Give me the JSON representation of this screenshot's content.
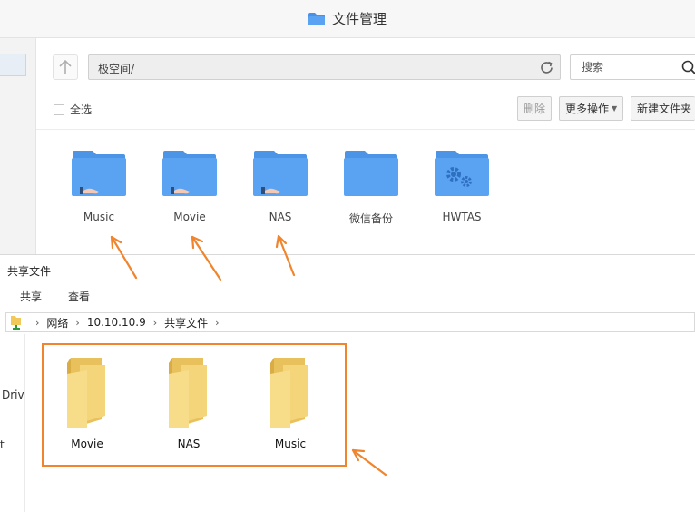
{
  "file_manager": {
    "title": "文件管理",
    "path": "极空间/",
    "search_placeholder": "搜索",
    "select_all": "全选",
    "buttons": {
      "delete": "删除",
      "more_ops": "更多操作",
      "new_folder": "新建文件夹"
    },
    "folders": [
      {
        "name": "Music",
        "shared": true
      },
      {
        "name": "Movie",
        "shared": true
      },
      {
        "name": "NAS",
        "shared": true
      },
      {
        "name": "微信备份",
        "shared": false
      },
      {
        "name": "HWTAS",
        "shared": false
      }
    ]
  },
  "explorer": {
    "title": "共享文件",
    "ribbon": [
      "共享",
      "查看"
    ],
    "breadcrumb": [
      "网络",
      "10.10.10.9",
      "共享文件"
    ],
    "nav": {
      "drive_text": "Driv",
      "partial_text": "t"
    },
    "folders": [
      "Movie",
      "NAS",
      "Music"
    ]
  },
  "colors": {
    "folder_blue": "#5aa3f2",
    "folder_blue_tab": "#4b94e6",
    "folder_yellow": "#f5d57a",
    "annotation_orange": "#f0852d"
  }
}
